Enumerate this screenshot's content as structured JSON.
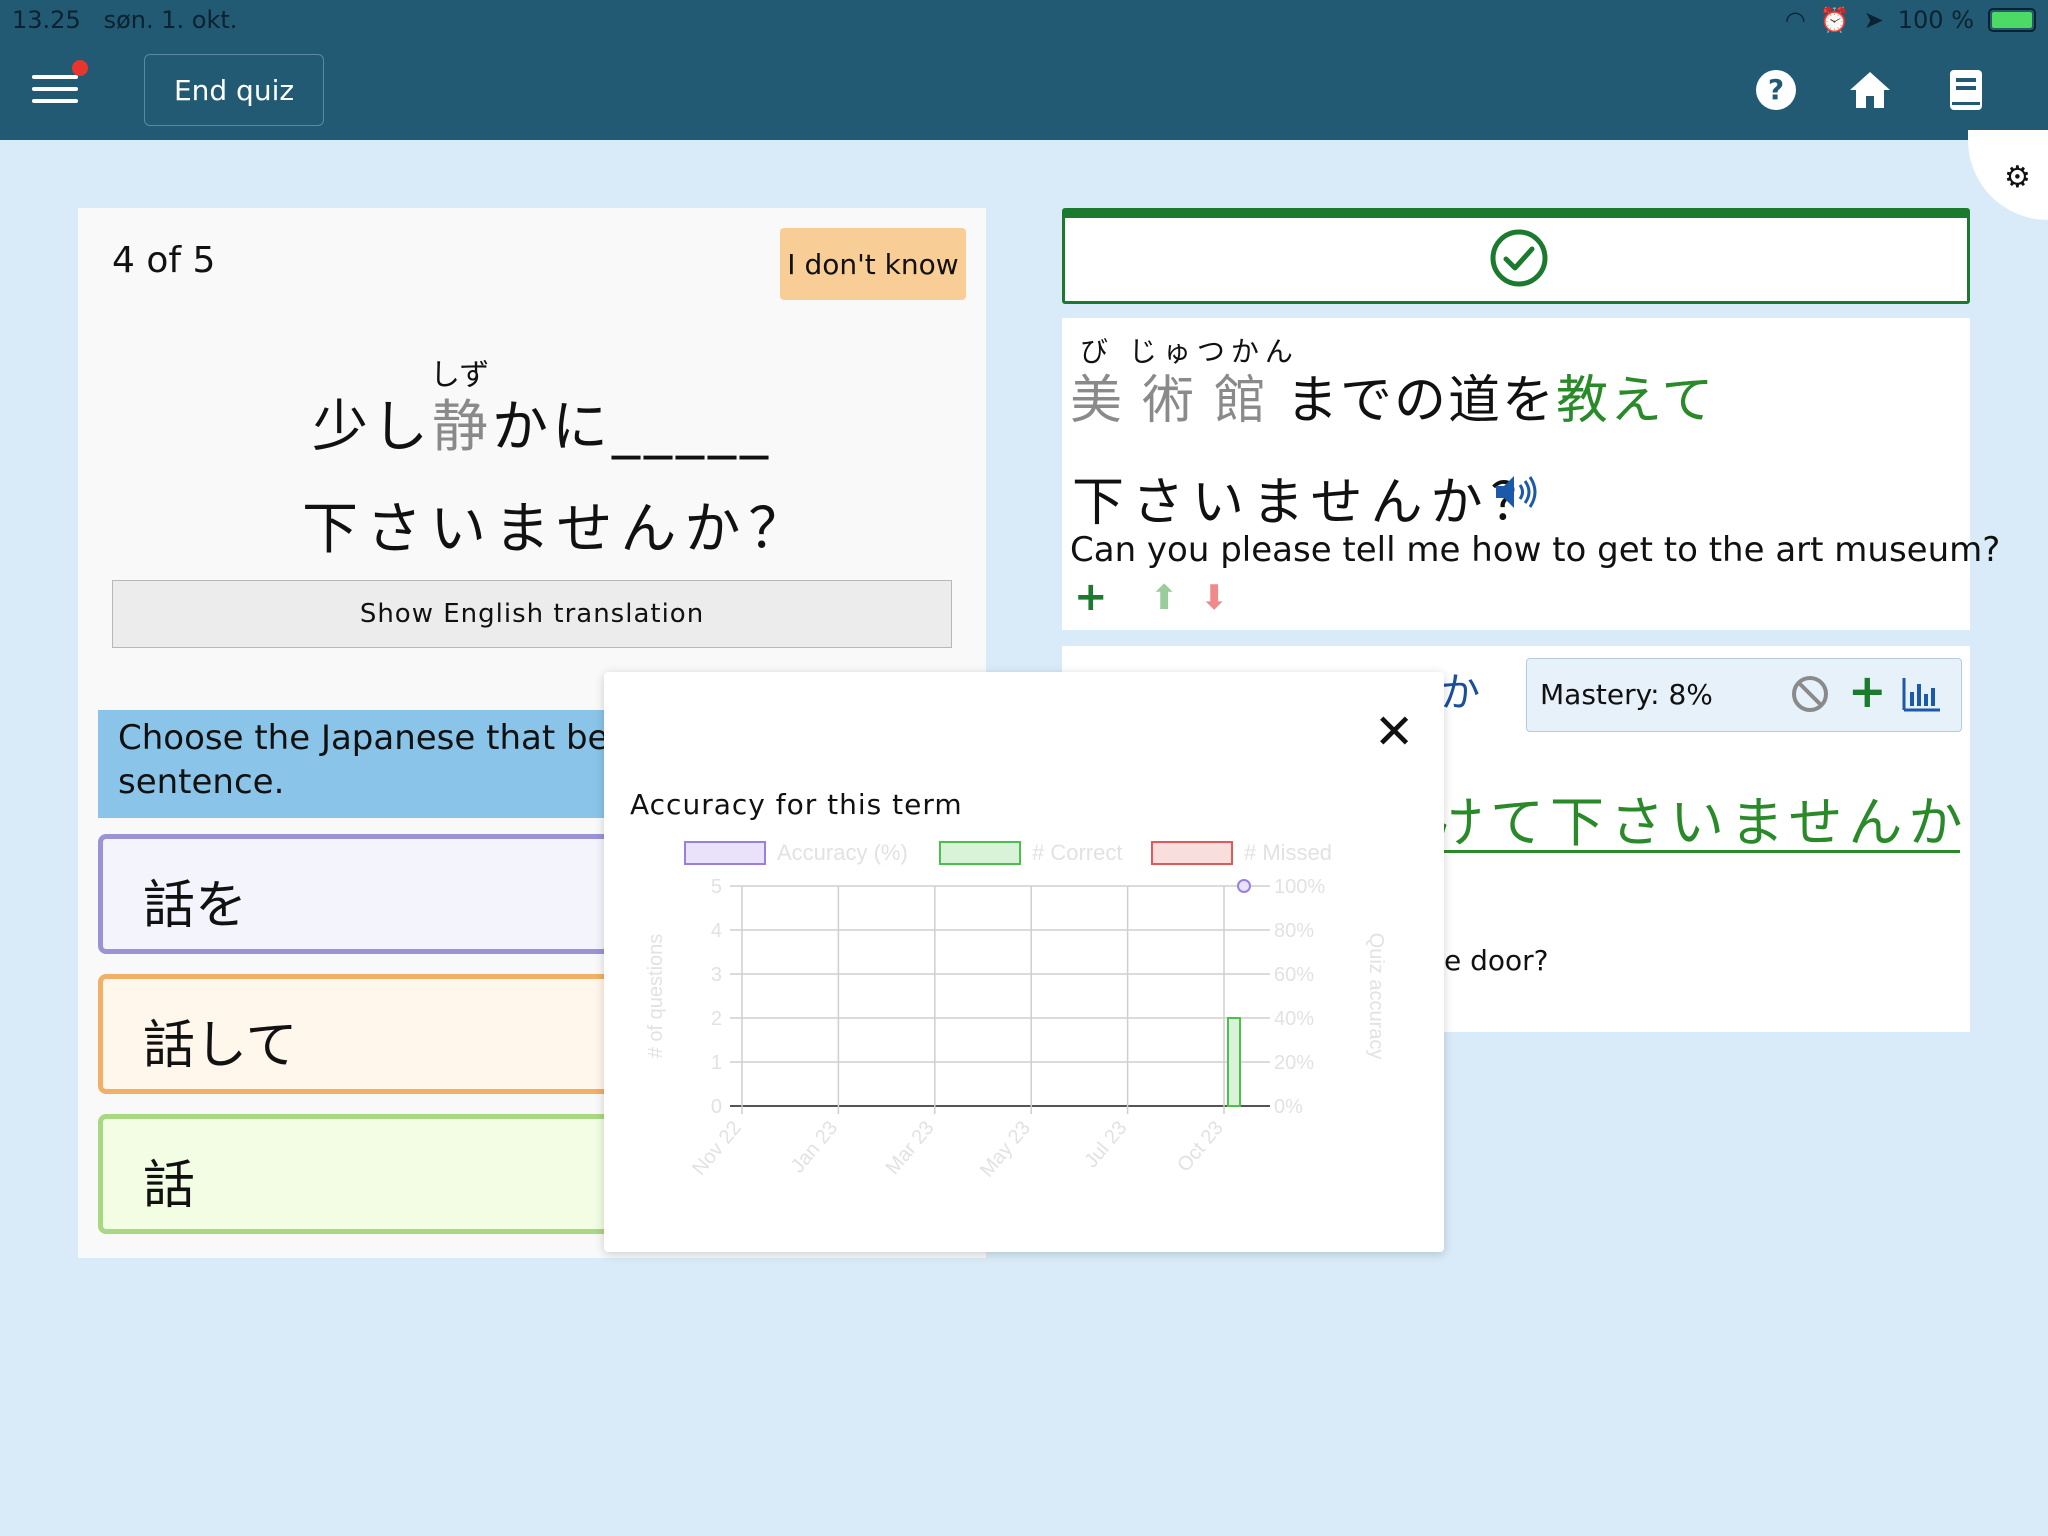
{
  "status_bar": {
    "time": "13.25",
    "date": "søn. 1. okt.",
    "battery": "100 %"
  },
  "toolbar": {
    "end_quiz": "End quiz",
    "icons": [
      "menu-icon",
      "help-icon",
      "home-icon",
      "book-icon",
      "gear-icon"
    ]
  },
  "quiz": {
    "counter": "4 of 5",
    "dont_know": "I don't know",
    "furigana": "しず",
    "line1_pre": "少し",
    "line1_kanji": "静",
    "line1_post": "かに_____",
    "line2": "下さいませんか？",
    "show_translation": "Show English translation",
    "instruction": "Choose the Japanese that best\nsentence.",
    "answers": [
      "話を",
      "話して",
      "話"
    ]
  },
  "result": {
    "furigana": "び じゅつかん",
    "line1_kanji": "美術館",
    "line1_mid": "までの道を",
    "line1_green": "教えて",
    "line2": "下さいませんか？",
    "english": "Can you please tell me how to get to the art museum?"
  },
  "term": {
    "kana_partial": "か",
    "mastery": "Mastery: 8%",
    "green_text": "けて下さいませんか",
    "english_partial": "e door?"
  },
  "modal": {
    "title": "Accuracy for this term",
    "close": "✕"
  },
  "chart_data": {
    "type": "bar",
    "legend": [
      "Accuracy (%)",
      "# Correct",
      "# Missed"
    ],
    "x_ticks": [
      "Nov 22",
      "Jan 23",
      "Mar 23",
      "May 23",
      "Jul 23",
      "Oct 23"
    ],
    "y_left_ticks": [
      "0",
      "1",
      "2",
      "3",
      "4",
      "5"
    ],
    "y_right_ticks": [
      "0%",
      "20%",
      "40%",
      "60%",
      "80%",
      "100%"
    ],
    "ylabel_left": "# of questions",
    "ylabel_right": "Quiz accuracy",
    "ylim": [
      0,
      5
    ],
    "series": [
      {
        "name": "# Correct",
        "points": [
          {
            "x": "Oct 23",
            "y": 2
          }
        ]
      },
      {
        "name": "Accuracy (%)",
        "points": [
          {
            "x": "Oct 23",
            "y": 100
          }
        ]
      }
    ],
    "colors": {
      "accuracy": "#9b7fe0",
      "correct": "#4cbf4c",
      "missed": "#e05a5a"
    }
  }
}
